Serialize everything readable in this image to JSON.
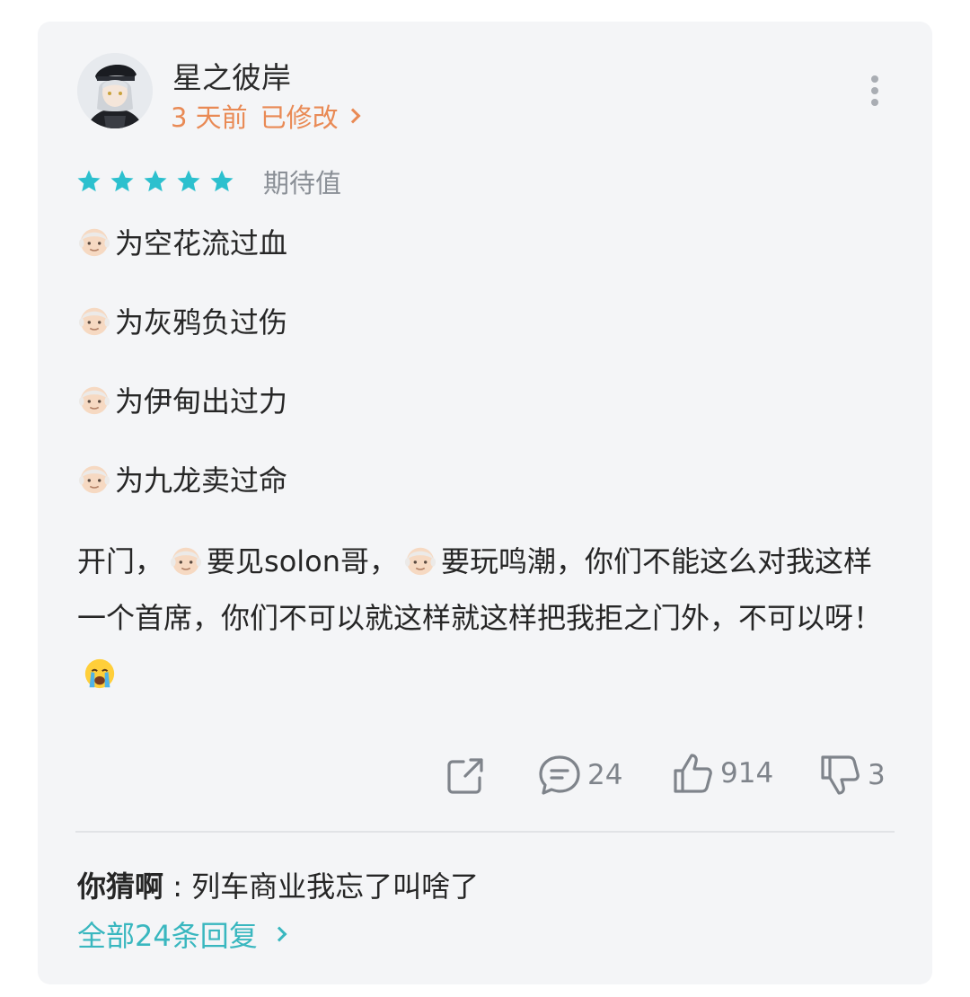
{
  "review": {
    "username": "星之彼岸",
    "time": "3 天前",
    "edited": "已修改",
    "rating_stars": 5,
    "rating_label": "期待值",
    "lines": [
      "为空花流过血",
      "为灰鸦负过伤",
      "为伊甸出过力",
      "为九龙卖过命"
    ],
    "paragraph": {
      "p1": "开门，",
      "p2": "要见solon哥，",
      "p3": "要玩鸣潮，你们不能这么对我这样一个首席，你们不可以就这样就这样把我拒之门外，不可以呀！"
    }
  },
  "actions": {
    "comments": "24",
    "likes": "914",
    "dislikes": "3"
  },
  "reply": {
    "author": "你猜啊",
    "separator": " : ",
    "text": "列车商业我忘了叫啥了",
    "all_replies": "全部24条回复"
  },
  "colors": {
    "accent_teal": "#39b7bf",
    "star": "#2cc0ce",
    "meta_orange": "#e98a55",
    "card_bg": "#f4f5f7"
  },
  "icons": [
    "more-vertical-icon",
    "star-icon",
    "old-man-emoji-icon",
    "crying-emoji-icon",
    "share-icon",
    "comment-icon",
    "thumbs-up-icon",
    "thumbs-down-icon",
    "chevron-right-icon"
  ]
}
